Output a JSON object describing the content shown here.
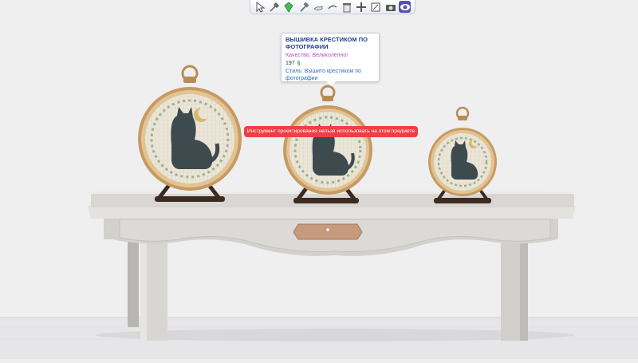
{
  "toolbar": {
    "tools": [
      {
        "name": "select-tool",
        "icon": "cursor-arrow-icon"
      },
      {
        "name": "eyedropper-tool",
        "icon": "eyedropper-icon"
      },
      {
        "name": "design-tool",
        "icon": "green-diamond-icon"
      },
      {
        "name": "sledgehammer-tool",
        "icon": "hammer-icon"
      },
      {
        "name": "hand-tool",
        "icon": "hand-icon"
      },
      {
        "name": "rotate-tool",
        "icon": "rotate-icon"
      },
      {
        "name": "sell-tool",
        "icon": "trash-icon"
      },
      {
        "name": "move-tool",
        "icon": "move-icon"
      },
      {
        "name": "cut-tool",
        "icon": "cut-icon"
      },
      {
        "name": "camera-tool",
        "icon": "camera-icon"
      },
      {
        "name": "live-mode-tool",
        "icon": "live-mode-icon"
      }
    ]
  },
  "tooltip": {
    "title": "ВЫШИВКА КРЕСТИКОМ ПО ФОТОГРАФИИ",
    "quality": "Качество: Великолепно!",
    "price": "197",
    "currency": "§",
    "style": "Стиль: Вышито крестиком по фотографии"
  },
  "warning": "Инструмент проектирования нельзя использовать на этом предмете",
  "colors": {
    "wall": "#ededee",
    "floor": "#e8e8ea",
    "table": "#d5d3d0",
    "hoop": "#c7a97a",
    "warning_bg": "#ef3e44",
    "tooltip_title": "#1d3f8f",
    "quality_text": "#b14fcf",
    "style_text": "#2b6fbf",
    "currency": "#2fa84f"
  }
}
